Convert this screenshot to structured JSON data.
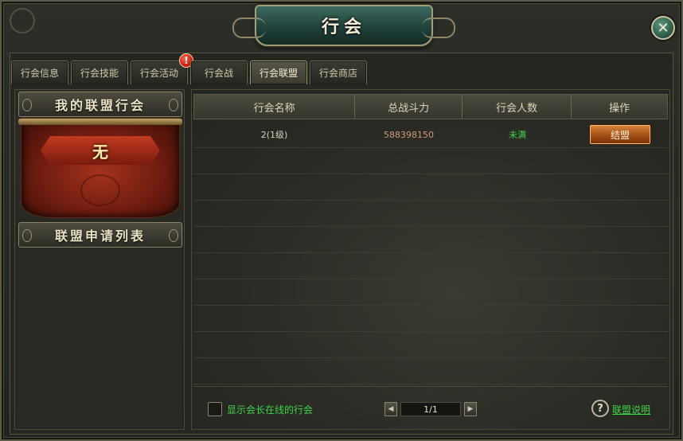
{
  "window": {
    "title": "行会"
  },
  "tabs": [
    {
      "label": "行会信息",
      "active": false,
      "alert": false
    },
    {
      "label": "行会技能",
      "active": false,
      "alert": false
    },
    {
      "label": "行会活动",
      "active": false,
      "alert": true
    },
    {
      "label": "行会战",
      "active": false,
      "alert": false
    },
    {
      "label": "行会联盟",
      "active": true,
      "alert": false
    },
    {
      "label": "行会商店",
      "active": false,
      "alert": false
    }
  ],
  "left": {
    "my_alliance_header": "我的联盟行会",
    "my_alliance_value": "无",
    "apply_list_header": "联盟申请列表"
  },
  "table": {
    "headers": {
      "name": "行会名称",
      "power": "总战斗力",
      "members": "行会人数",
      "op": "操作"
    },
    "rows": [
      {
        "name": "2(1级)",
        "power": "588398150",
        "members": "未满",
        "action": "结盟"
      }
    ]
  },
  "footer": {
    "checkbox_label": "显示会长在线的行会",
    "checkbox_checked": false,
    "page": "1/1",
    "help_icon": "?",
    "help_link": "联盟说明"
  },
  "colors": {
    "accent_green": "#3fd44a",
    "action_orange": "#d4833a",
    "title_teal": "#3c6a60"
  }
}
